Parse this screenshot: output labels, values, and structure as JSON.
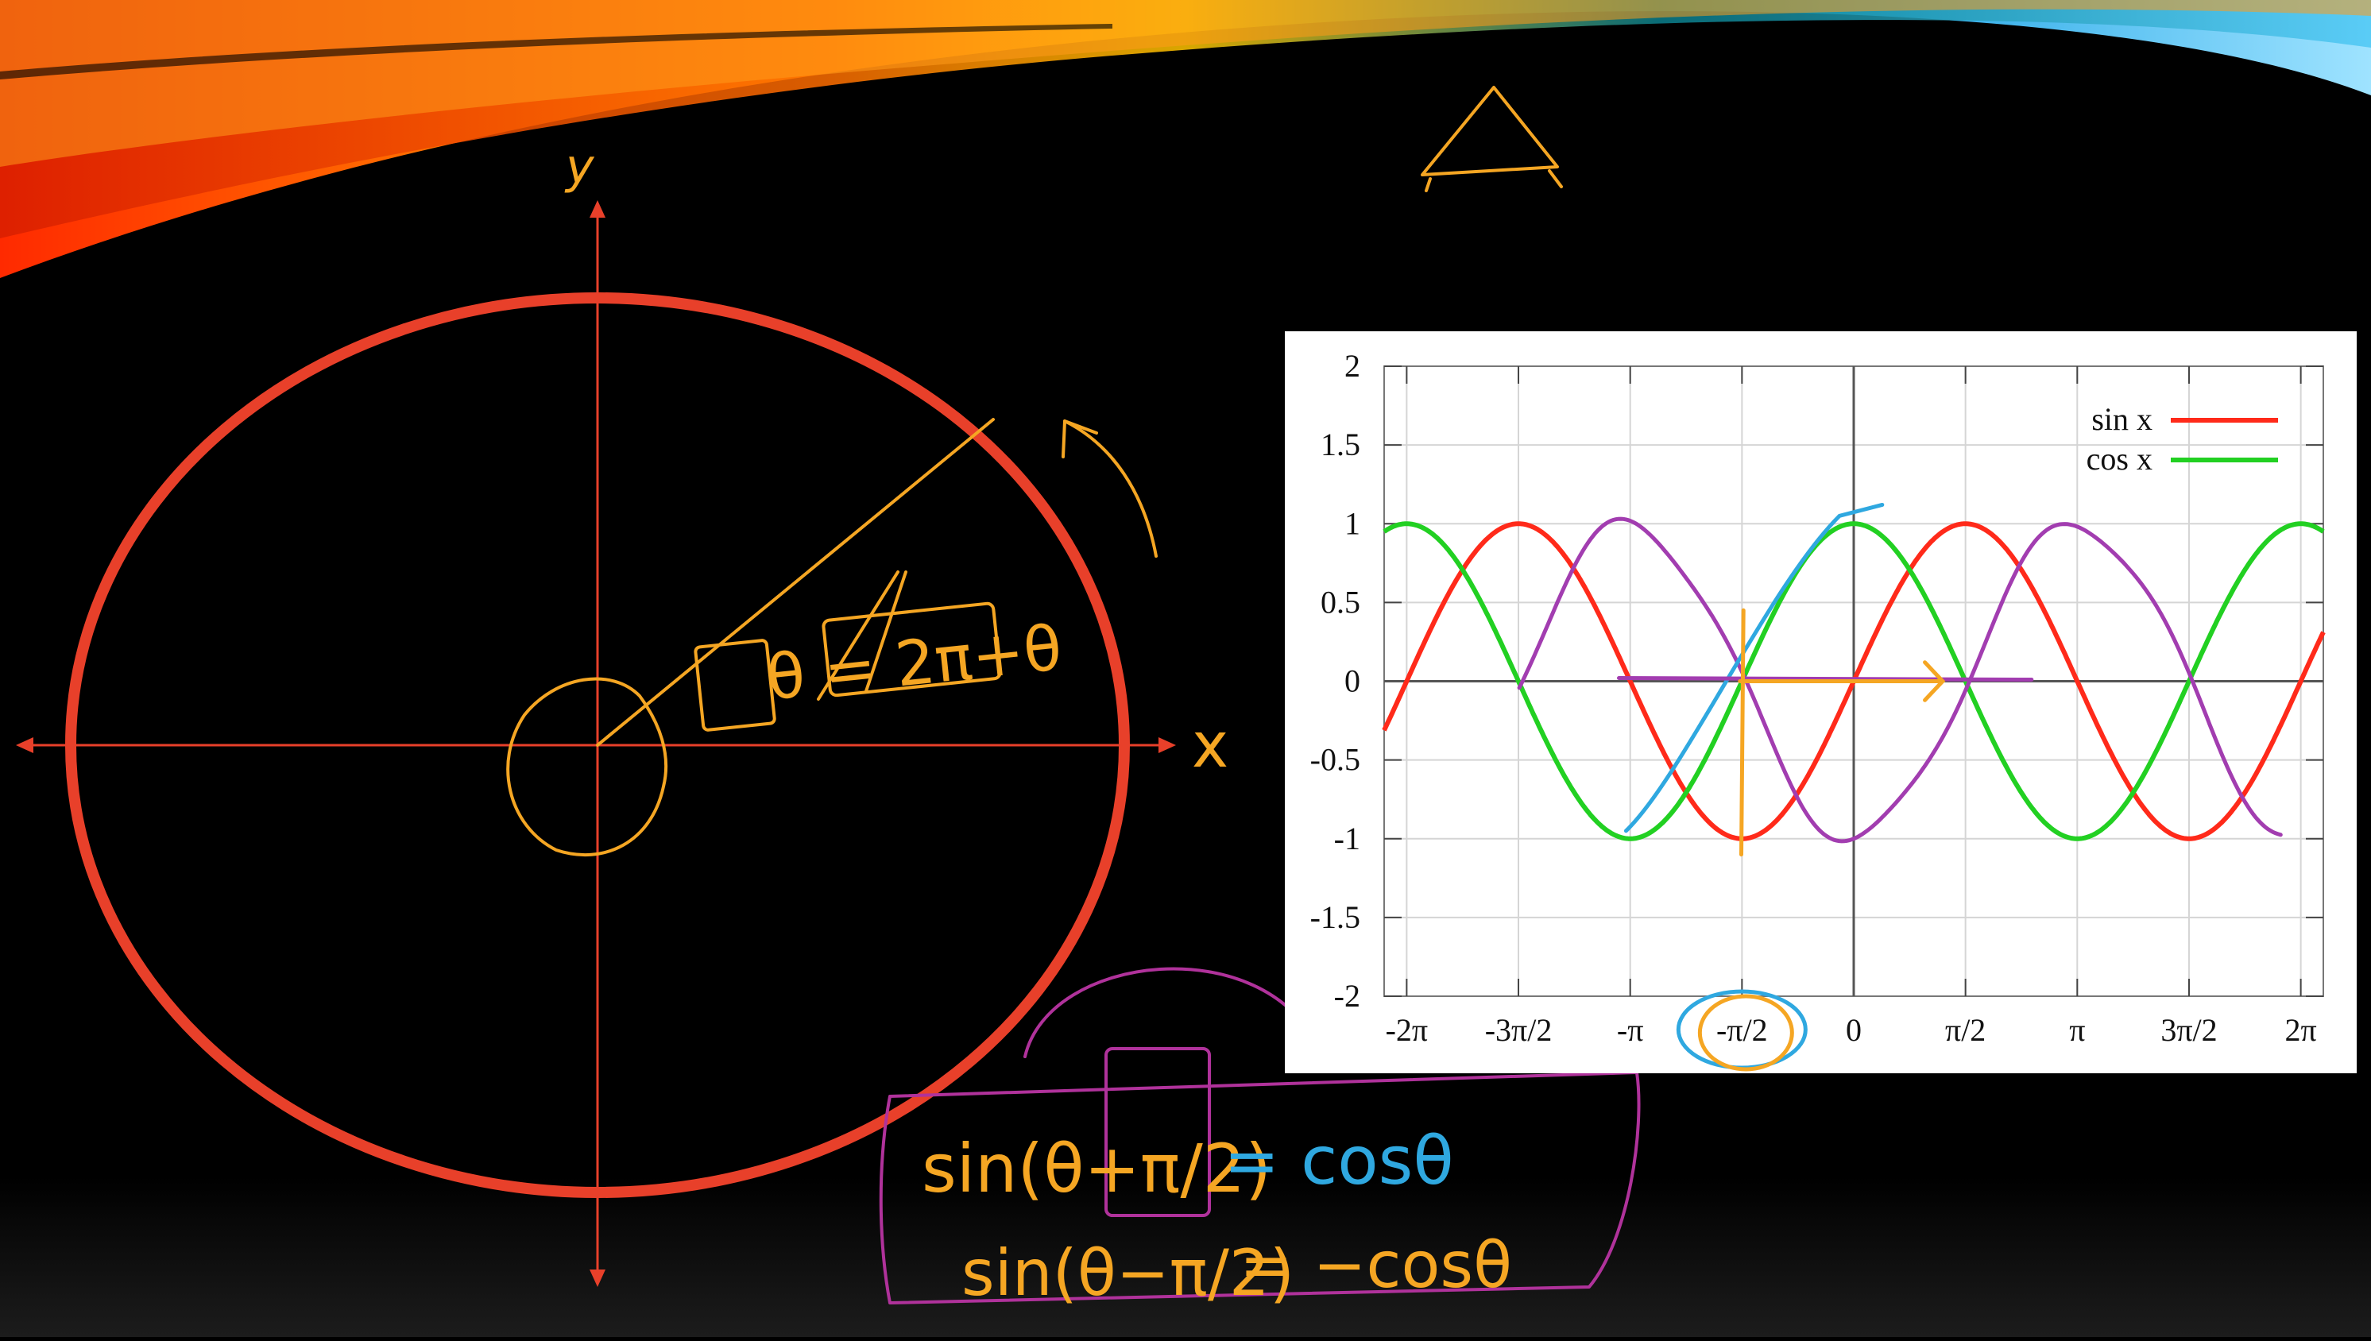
{
  "slide": {
    "axis_x_label": "x",
    "axis_y_label": "y",
    "circle_color": "#e8402a",
    "ink_orange": "#f5a623",
    "ink_purple": "#b0329b",
    "ink_blue": "#2fa8e0",
    "annotation_theta_eq": "θ = 2π+θ",
    "formula_1_left": "sin(θ+π/2)",
    "formula_1_right": "= cosθ",
    "formula_2_left": "sin(θ−π/2)",
    "formula_2_right": "= −cosθ"
  },
  "chart_data": {
    "type": "line",
    "xlim": [
      -6.6,
      6.6
    ],
    "ylim": [
      -2,
      2
    ],
    "x_ticks": [
      {
        "value": -6.2832,
        "label": "-2π"
      },
      {
        "value": -4.7124,
        "label": "-3π/2"
      },
      {
        "value": -3.1416,
        "label": "-π"
      },
      {
        "value": -1.5708,
        "label": "-π/2"
      },
      {
        "value": 0,
        "label": "0"
      },
      {
        "value": 1.5708,
        "label": "π/2"
      },
      {
        "value": 3.1416,
        "label": "π"
      },
      {
        "value": 4.7124,
        "label": "3π/2"
      },
      {
        "value": 6.2832,
        "label": "2π"
      }
    ],
    "y_ticks": [
      {
        "value": 2,
        "label": "2"
      },
      {
        "value": 1.5,
        "label": "1.5"
      },
      {
        "value": 1,
        "label": "1"
      },
      {
        "value": 0.5,
        "label": "0.5"
      },
      {
        "value": 0,
        "label": "0"
      },
      {
        "value": -0.5,
        "label": "-0.5"
      },
      {
        "value": -1,
        "label": "-1"
      },
      {
        "value": -1.5,
        "label": "-1.5"
      },
      {
        "value": -2,
        "label": "-2"
      }
    ],
    "grid": true,
    "legend_position": "top-right",
    "series": [
      {
        "name": "sin x",
        "function": "sin",
        "color": "#ff2a1a"
      },
      {
        "name": "cos x",
        "function": "cos",
        "color": "#22d022"
      }
    ],
    "annotation_series": {
      "function": "-cos",
      "color": "#a23db0"
    }
  }
}
